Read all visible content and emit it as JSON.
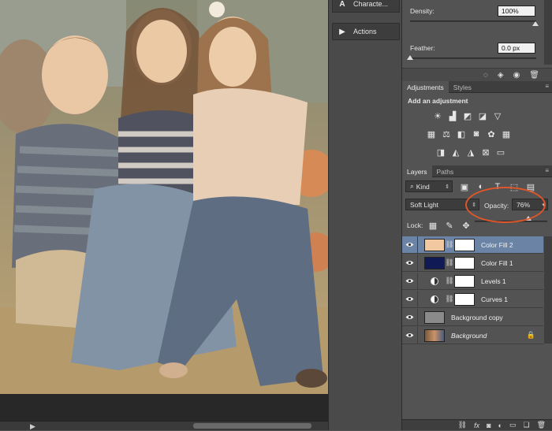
{
  "colors": {
    "accent": "#e0552a",
    "selection": "#6b84a6",
    "color_fill_2": "#f2c8a0",
    "color_fill_1": "#101a55"
  },
  "middle_dock": {
    "items": [
      {
        "label": "Characte...",
        "icon": "character-icon"
      },
      {
        "label": "Actions",
        "icon": "play-icon"
      }
    ]
  },
  "properties": {
    "density_label": "Density:",
    "density_value": "100%",
    "feather_label": "Feather:",
    "feather_value": "0.0 px"
  },
  "adjustments": {
    "tabs": [
      "Adjustments",
      "Styles"
    ],
    "heading": "Add an adjustment"
  },
  "layers": {
    "tabs": [
      "Layers",
      "Paths"
    ],
    "kind_label": "Kind",
    "blend_mode": "Soft Light",
    "opacity_label": "Opacity:",
    "opacity_value": "76%",
    "lock_label": "Lock:",
    "items": [
      {
        "name": "Color Fill 2",
        "type": "fill",
        "selected": true
      },
      {
        "name": "Color Fill 1",
        "type": "fill",
        "selected": false
      },
      {
        "name": "Levels 1",
        "type": "adjustment",
        "selected": false
      },
      {
        "name": "Curves 1",
        "type": "adjustment",
        "selected": false
      },
      {
        "name": "Background copy",
        "type": "pixel",
        "selected": false
      },
      {
        "name": "Background",
        "type": "background",
        "selected": false
      }
    ]
  }
}
